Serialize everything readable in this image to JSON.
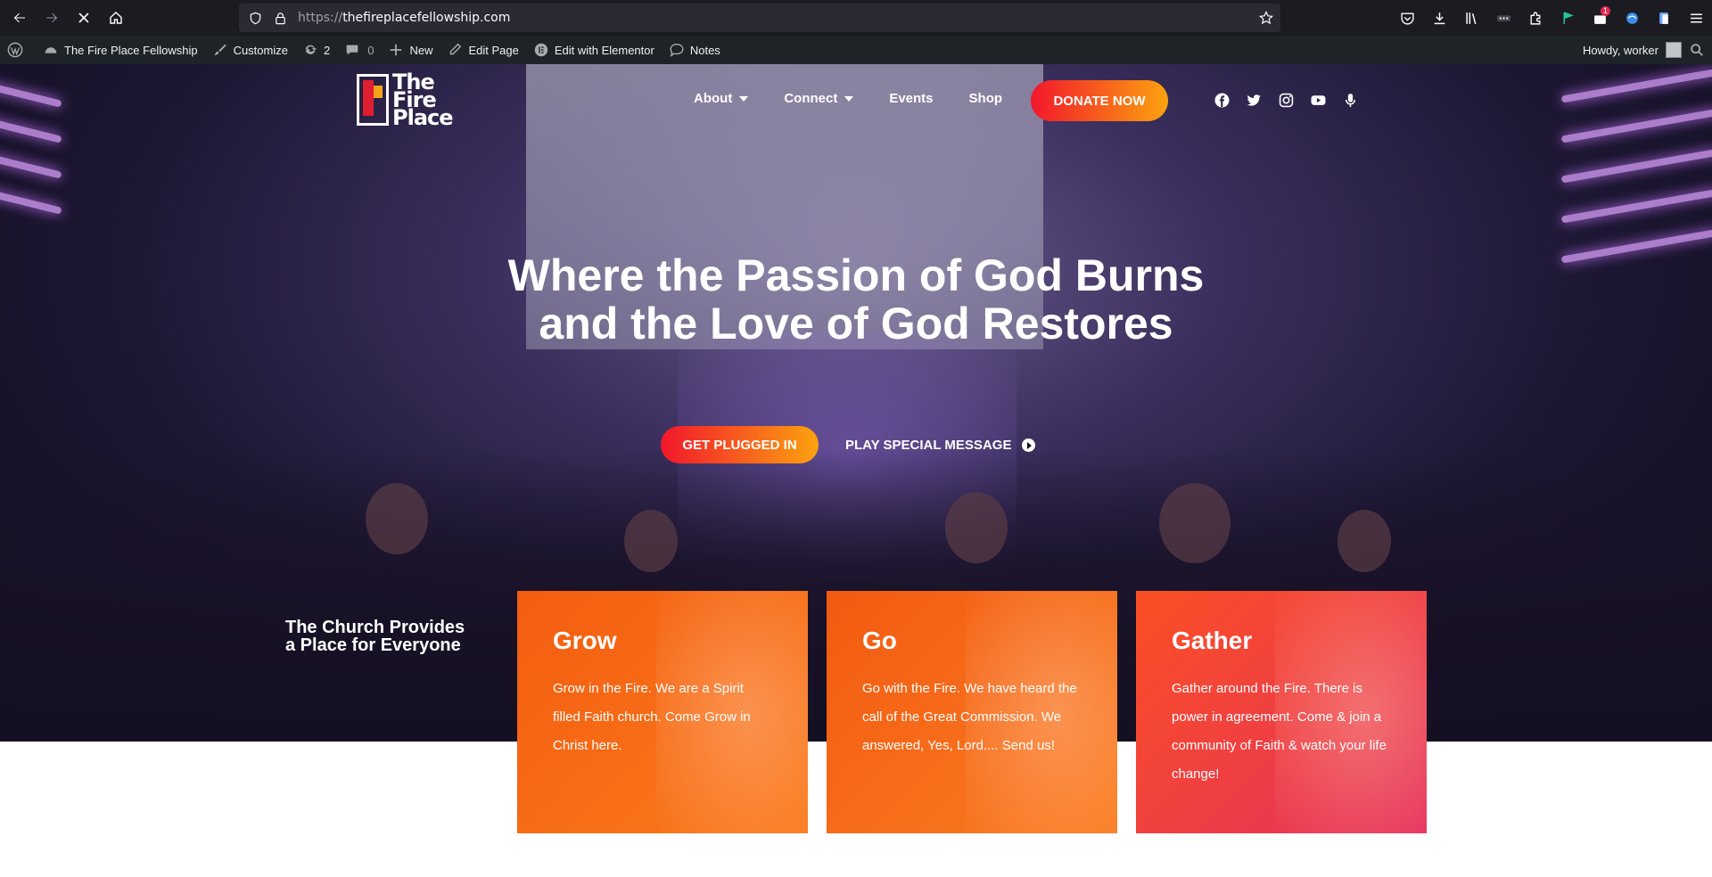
{
  "browser": {
    "url_protocol": "https://",
    "url_host": "thefireplacefellowship.com",
    "notification_count": "1"
  },
  "wpbar": {
    "site_name": "The Fire Place Fellowship",
    "customize": "Customize",
    "updates_count": "2",
    "comments_count": "0",
    "new": "New",
    "edit_page": "Edit Page",
    "edit_elementor": "Edit with Elementor",
    "notes": "Notes",
    "howdy": "Howdy, worker"
  },
  "header": {
    "logo_line1": "The",
    "logo_line2": "Fire",
    "logo_line3": "Place",
    "menu": [
      "About",
      "Connect",
      "Events",
      "Shop"
    ],
    "donate": "DONATE NOW",
    "social_icons": [
      "facebook-icon",
      "twitter-icon",
      "instagram-icon",
      "youtube-icon",
      "podcast-icon"
    ]
  },
  "hero": {
    "headline": "Where the Passion of God Burns and the Love of God Restores",
    "cta_primary": "GET PLUGGED IN",
    "cta_secondary": "PLAY SPECIAL MESSAGE",
    "tagline": "The Church Provides a Place for Everyone"
  },
  "cards": [
    {
      "title": "Grow",
      "text": "Grow in the Fire. We are a Spirit filled Faith church. Come Grow in Christ here."
    },
    {
      "title": "Go",
      "text": "Go with the Fire. We have heard the call of the Great Commission. We answered, Yes, Lord.... Send us!"
    },
    {
      "title": "Gather",
      "text": "Gather around the Fire. There is power in agreement. Come & join a community of Faith & watch your life change!"
    }
  ],
  "colors": {
    "accent_red": "#f2172c",
    "accent_orange": "#fca30f",
    "wp_bar": "#1d2327"
  }
}
